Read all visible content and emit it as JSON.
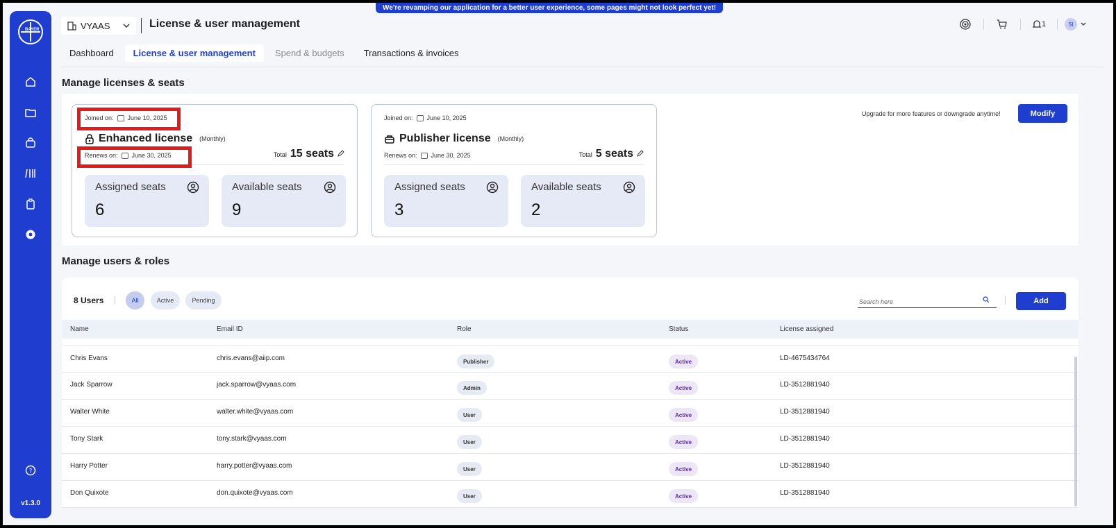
{
  "banner": "We're revamping our application for a better user experience, some pages might not look perfect yet!",
  "sidebar": {
    "logo_text": "BAYER",
    "version": "v1.3.0"
  },
  "header": {
    "org": "VYAAS",
    "title": "License & user management",
    "notifications": "1",
    "avatar": "SI"
  },
  "tabs": [
    "Dashboard",
    "License & user management",
    "Spend & budgets",
    "Transactions & invoices"
  ],
  "licenses": {
    "section_title": "Manage licenses & seats",
    "upgrade_text": "Upgrade for more features or downgrade anytime!",
    "modify_label": "Modify",
    "joined_label": "Joined on:",
    "renews_label": "Renews on:",
    "total_label": "Total",
    "assigned_label": "Assigned seats",
    "available_label": "Available seats",
    "cards": [
      {
        "name": "Enhanced license",
        "period": "(Monthly)",
        "joined": "June 10, 2025",
        "renews": "June 30, 2025",
        "total": "15 seats",
        "assigned": "6",
        "available": "9"
      },
      {
        "name": "Publisher license",
        "period": "(Monthly)",
        "joined": "June 10, 2025",
        "renews": "June 30, 2025",
        "total": "5 seats",
        "assigned": "3",
        "available": "2"
      }
    ]
  },
  "users": {
    "section_title": "Manage users & roles",
    "count": "8 Users",
    "filters": [
      "All",
      "Active",
      "Pending"
    ],
    "search_placeholder": "Search here",
    "add_label": "Add",
    "columns": [
      "Name",
      "Email ID",
      "Role",
      "Status",
      "License assigned"
    ],
    "rows": [
      {
        "name": "Chris Evans",
        "email": "chris.evans@aiip.com",
        "role": "Publisher",
        "status": "Active",
        "license": "LD-4675434764"
      },
      {
        "name": "Jack Sparrow",
        "email": "jack.sparrow@vyaas.com",
        "role": "Admin",
        "status": "Active",
        "license": "LD-3512881940"
      },
      {
        "name": "Walter White",
        "email": "walter.white@vyaas.com",
        "role": "User",
        "status": "Active",
        "license": "LD-3512881940"
      },
      {
        "name": "Tony Stark",
        "email": "tony.stark@vyaas.com",
        "role": "User",
        "status": "Active",
        "license": "LD-3512881940"
      },
      {
        "name": "Harry Potter",
        "email": "harry.potter@vyaas.com",
        "role": "User",
        "status": "Active",
        "license": "LD-3512881940"
      },
      {
        "name": "Don Quixote",
        "email": "don.quixote@vyaas.com",
        "role": "User",
        "status": "Active",
        "license": "LD-3512881940"
      }
    ]
  },
  "colors": {
    "brand": "#1f3ecf",
    "highlight": "#e21c1c",
    "status_text": "#5b2ca0"
  }
}
